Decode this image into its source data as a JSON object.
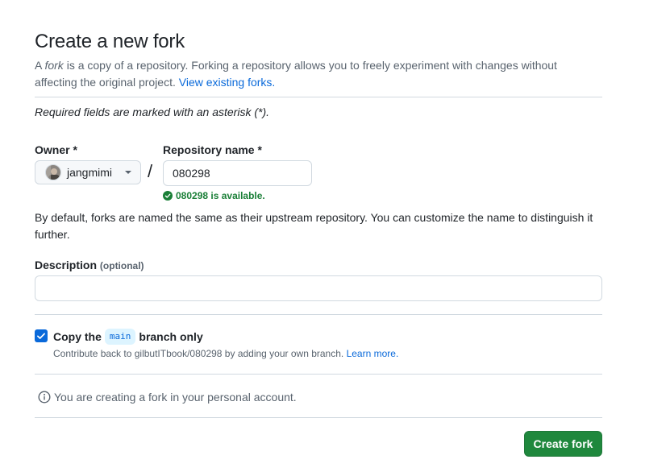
{
  "header": {
    "title": "Create a new fork",
    "subtitle_prefix": "A ",
    "subtitle_fork": "fork",
    "subtitle_body": " is a copy of a repository. Forking a repository allows you to freely experiment with changes without affecting the original project. ",
    "view_forks_link": "View existing forks."
  },
  "form": {
    "required_note": "Required fields are marked with an asterisk (*).",
    "owner": {
      "label": "Owner *",
      "value": "jangmimi"
    },
    "separator": "/",
    "repository": {
      "label": "Repository name *",
      "value": "080298",
      "availability": "080298 is available."
    },
    "naming_help": "By default, forks are named the same as their upstream repository. You can customize the name to distinguish it further.",
    "description": {
      "label": "Description",
      "optional": "(optional)",
      "value": ""
    },
    "copy_branch": {
      "checked": true,
      "label_prefix": "Copy the",
      "branch": "main",
      "label_suffix": "branch only",
      "hint": "Contribute back to gilbutITbook/080298 by adding your own branch. ",
      "learn_more": "Learn more."
    },
    "info": "You are creating a fork in your personal account.",
    "submit_label": "Create fork"
  },
  "icons": {
    "avatar": "user-avatar",
    "dropdown": "triangle-down-icon",
    "available": "check-circle-fill-icon",
    "checkbox": "checkmark-icon",
    "info": "info-icon"
  },
  "colors": {
    "link": "#0969da",
    "success": "#1a7f37",
    "primary_button": "#1f883d",
    "checkbox": "#0969da"
  }
}
